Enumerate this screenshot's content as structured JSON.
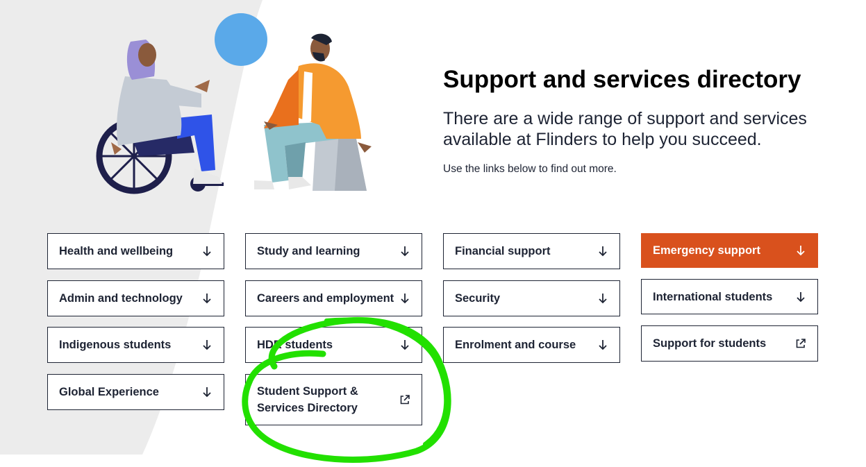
{
  "hero": {
    "title": "Support and services directory",
    "lead": "There are a wide range of support and services available at Flinders to help you succeed.",
    "sub": "Use the links below to find out more."
  },
  "cards": {
    "col1": [
      {
        "label": "Health and wellbeing",
        "icon": "arrow-down-icon"
      },
      {
        "label": "Admin and technology",
        "icon": "arrow-down-icon"
      },
      {
        "label": "Indigenous students",
        "icon": "arrow-down-icon"
      },
      {
        "label": "Global Experience",
        "icon": "arrow-down-icon"
      }
    ],
    "col2": [
      {
        "label": "Study and learning",
        "icon": "arrow-down-icon"
      },
      {
        "label": "Careers and employment",
        "icon": "arrow-down-icon"
      },
      {
        "label": "HDR students",
        "icon": "arrow-down-icon"
      },
      {
        "label": "Student Support & Services Directory",
        "icon": "external-link-icon"
      }
    ],
    "col3": [
      {
        "label": "Financial support",
        "icon": "arrow-down-icon"
      },
      {
        "label": "Security",
        "icon": "arrow-down-icon"
      },
      {
        "label": "Enrolment and course",
        "icon": "arrow-down-icon"
      }
    ],
    "col4": [
      {
        "label": "Emergency support",
        "icon": "arrow-down-icon"
      },
      {
        "label": "International students",
        "icon": "arrow-down-icon"
      },
      {
        "label": "Support for students",
        "icon": "external-link-icon"
      }
    ]
  },
  "colors": {
    "emergency": "#d9511d",
    "border": "#1d2333",
    "annotation": "#22e000",
    "background_shape": "#ececec"
  }
}
